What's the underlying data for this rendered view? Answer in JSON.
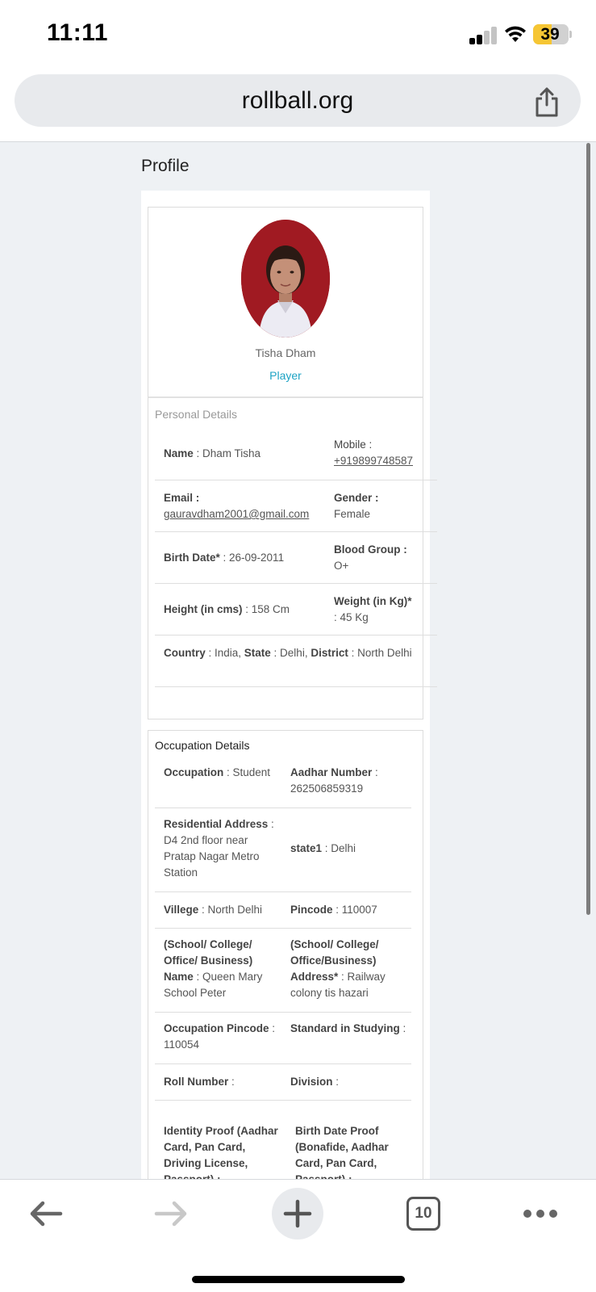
{
  "status_bar": {
    "time": "11:11",
    "battery": "39"
  },
  "browser": {
    "url": "rollball.org",
    "tab_count": "10"
  },
  "page": {
    "title": "Profile"
  },
  "profile": {
    "name": "Tisha Dham",
    "role": "Player"
  },
  "personal": {
    "title": "Personal Details",
    "name_label": "Name",
    "name_value": " : Dham Tisha",
    "mobile_label": "Mobile :",
    "mobile_value": "+919899748587",
    "email_label": "Email :",
    "email_value": "gauravdham2001@gmail.com",
    "gender_label": "Gender :",
    "gender_value": "Female",
    "birth_label": "Birth Date*",
    "birth_value": " : 26-09-2011",
    "blood_label": "Blood Group :",
    "blood_value": "O+",
    "height_label": "Height (in cms)",
    "height_value": " : 158 Cm",
    "weight_label": "Weight (in Kg)*",
    "weight_value": ": 45 Kg",
    "country_label": "Country",
    "country_value": " : India, ",
    "state_label": "State",
    "state_value": " : Delhi, ",
    "district_label": "District",
    "district_value": " : North Delhi"
  },
  "occupation": {
    "title": "Occupation Details",
    "occupation_label": "Occupation",
    "occupation_value": " : Student",
    "aadhar_label": "Aadhar Number",
    "aadhar_value": " : 262506859319",
    "res_label": "Residential Address",
    "res_value": " : D4 2nd floor near Pratap Nagar Metro Station",
    "state1_label": "state1",
    "state1_value": " : Delhi",
    "village_label": "Villege",
    "village_value": " : North Delhi",
    "pincode_label": "Pincode",
    "pincode_value": " : 110007",
    "school_name_label": "(School/ College/ Office/ Business) Name",
    "school_name_value": " : Queen Mary School Peter",
    "school_addr_label": "(School/ College/ Office/Business) Address*",
    "school_addr_value": " : Railway colony tis hazari",
    "occ_pin_label": "Occupation Pincode",
    "occ_pin_value": " : 110054",
    "standard_label": "Standard in Studying",
    "standard_value": " :",
    "roll_label": "Roll Number",
    "roll_value": " :",
    "division_label": "Division",
    "division_value": " :",
    "identity_label": "Identity Proof (Aadhar Card, Pan Card, Driving License, Passport) :",
    "birthproof_label": "Birth Date Proof (Bonafide, Aadhar Card, Pan Card, Passport) :"
  }
}
